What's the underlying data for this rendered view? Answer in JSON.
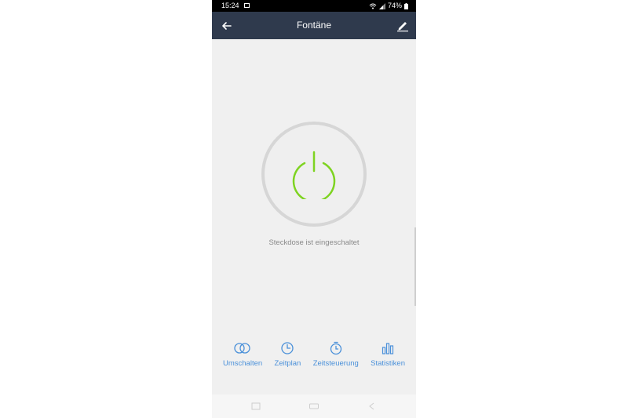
{
  "status_bar": {
    "time": "15:24",
    "battery": "74%"
  },
  "app_bar": {
    "title": "Fontäne",
    "back_icon": "arrow-left-icon",
    "edit_icon": "pencil-icon"
  },
  "power": {
    "state_text": "Steckdose ist eingeschaltet",
    "icon": "power-icon",
    "color": "#7ed321"
  },
  "tabs": [
    {
      "label": "Umschalten",
      "icon": "toggle-circles-icon"
    },
    {
      "label": "Zeitplan",
      "icon": "clock-icon"
    },
    {
      "label": "Zeitsteuerung",
      "icon": "stopwatch-icon"
    },
    {
      "label": "Statistiken",
      "icon": "bar-chart-icon"
    }
  ],
  "colors": {
    "app_bar": "#2f3a4d",
    "accent": "#4a90d9",
    "background": "#f0f0f0"
  }
}
